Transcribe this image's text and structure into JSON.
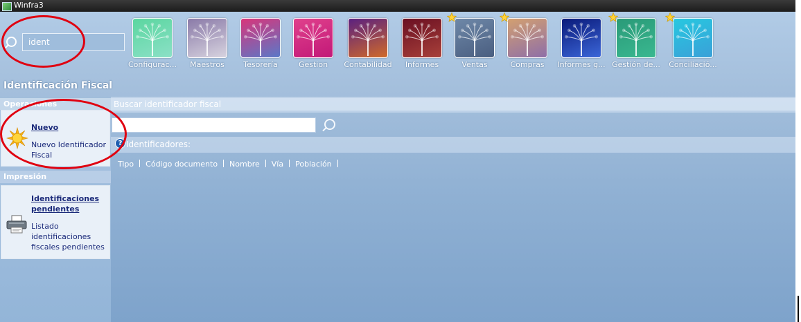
{
  "window": {
    "title": "Winfra3"
  },
  "menu_search": {
    "value": "ident"
  },
  "modules": [
    {
      "label": "Configurac...",
      "starred": false,
      "c1": "#5bd6a0",
      "c2": "#8be0c6"
    },
    {
      "label": "Maestros",
      "starred": false,
      "c1": "#8a7aa8",
      "c2": "#d7d3df"
    },
    {
      "label": "Tesorería",
      "starred": false,
      "c1": "#d8357a",
      "c2": "#5a78c8"
    },
    {
      "label": "Gestion",
      "starred": false,
      "c1": "#e0418c",
      "c2": "#c21878"
    },
    {
      "label": "Contabilidad",
      "starred": false,
      "c1": "#5a2080",
      "c2": "#d06a2a"
    },
    {
      "label": "Informes",
      "starred": false,
      "c1": "#6a0f22",
      "c2": "#a8403a"
    },
    {
      "label": "Ventas",
      "starred": true,
      "c1": "#6e88a8",
      "c2": "#4a5e80"
    },
    {
      "label": "Compras",
      "starred": true,
      "c1": "#d3a070",
      "c2": "#8e6ea8"
    },
    {
      "label": "Informes g...",
      "starred": false,
      "c1": "#0a1a7a",
      "c2": "#3b66d8"
    },
    {
      "label": "Gestión de...",
      "starred": true,
      "c1": "#2a9a78",
      "c2": "#3ab890"
    },
    {
      "label": "Conciliació...",
      "starred": true,
      "c1": "#27c8e0",
      "c2": "#3aa0d8"
    }
  ],
  "page_title": "Identificación Fiscal",
  "sidebar": {
    "operaciones_header": "Operaciones",
    "nuevo": {
      "title": "Nuevo",
      "desc_lines": [
        "Nuevo Identificador",
        "Fiscal"
      ]
    },
    "impresion_header": "Impresión",
    "pendientes": {
      "title_lines": [
        "Identificaciones",
        "pendientes"
      ],
      "desc_lines": [
        "Listado",
        "identificaciones",
        "fiscales pendientes"
      ]
    }
  },
  "content": {
    "search_header": "Buscar identificador fiscal",
    "search_value": "",
    "identificadores_label": "Identificadores:",
    "columns": [
      "Tipo",
      "Código documento",
      "Nombre",
      "Vía",
      "Población"
    ]
  },
  "colors": {
    "annotation": "#e00010",
    "link_text": "#1b2a7a"
  }
}
